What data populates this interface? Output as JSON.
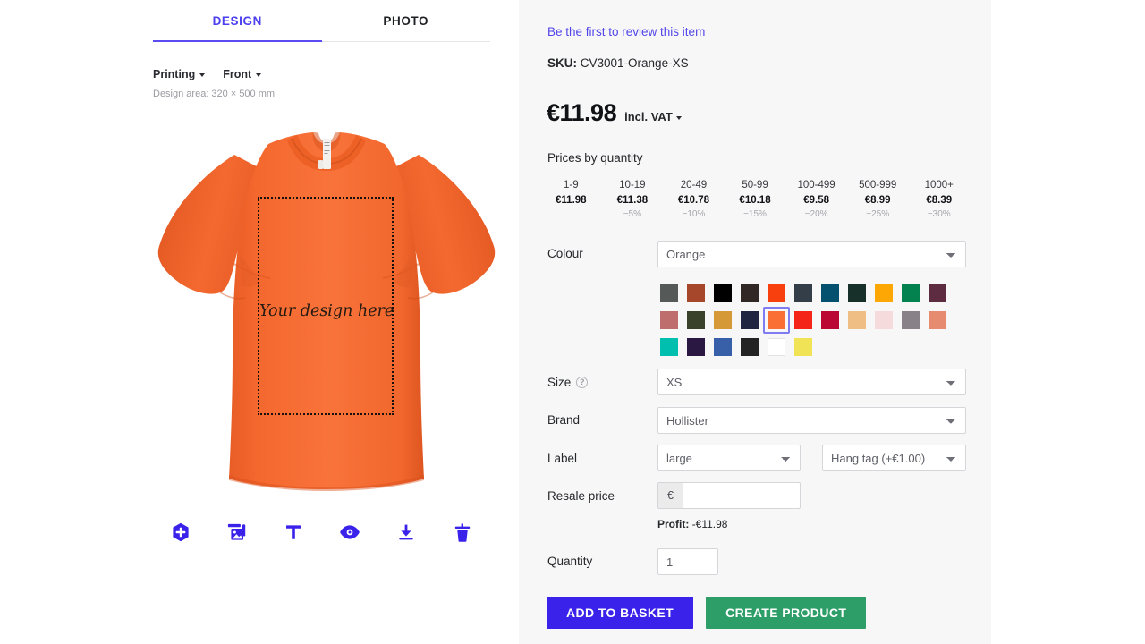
{
  "designer": {
    "tabs": [
      {
        "label": "DESIGN",
        "active": true
      },
      {
        "label": "PHOTO",
        "active": false
      }
    ],
    "controls": {
      "printing_label": "Printing",
      "side_label": "Front",
      "design_area_note": "Design area: 320 × 500 mm"
    },
    "canvas": {
      "design_hint": "Your design here",
      "shirt_colour_name": "Orange",
      "shirt_colour_hex": "#F4682E",
      "shirt_shadow_hex": "#E2551F"
    },
    "toolbar": [
      {
        "icon": "hexagon-plus-icon",
        "name": "add-element-button"
      },
      {
        "icon": "image-icon",
        "name": "add-image-button"
      },
      {
        "icon": "text-icon",
        "name": "add-text-button"
      },
      {
        "icon": "eye-icon",
        "name": "preview-button"
      },
      {
        "icon": "download-icon",
        "name": "download-button"
      },
      {
        "icon": "trash-icon",
        "name": "delete-button"
      }
    ],
    "accent_hex": "#4B3FF0"
  },
  "product": {
    "review_link": "Be the first to review this item",
    "sku_label": "SKU:",
    "sku_value": "CV3001-Orange-XS",
    "price": "€11.98",
    "vat_note": "incl. VAT",
    "qty_prices_title": "Prices by quantity",
    "qty_prices": [
      {
        "range": "1-9",
        "price": "€11.98",
        "discount": ""
      },
      {
        "range": "10-19",
        "price": "€11.38",
        "discount": "−5%"
      },
      {
        "range": "20-49",
        "price": "€10.78",
        "discount": "−10%"
      },
      {
        "range": "50-99",
        "price": "€10.18",
        "discount": "−15%"
      },
      {
        "range": "100-499",
        "price": "€9.58",
        "discount": "−20%"
      },
      {
        "range": "500-999",
        "price": "€8.99",
        "discount": "−25%"
      },
      {
        "range": "1000+",
        "price": "€8.39",
        "discount": "−30%"
      }
    ],
    "fields": {
      "colour_label": "Colour",
      "colour_value": "Orange",
      "size_label": "Size",
      "size_help": "?",
      "size_value": "XS",
      "brand_label": "Brand",
      "brand_value": "Hollister",
      "label_label": "Label",
      "label_size_value": "large",
      "label_type_value": "Hang tag (+€1.00)",
      "resale_label": "Resale price",
      "resale_prefix": "€",
      "resale_value": "",
      "resale_placeholder": "",
      "profit_label": "Profit:",
      "profit_value": "-€11.98",
      "quantity_label": "Quantity",
      "quantity_value": "1"
    },
    "swatches": [
      {
        "hex": "#555A59",
        "name": "asphalt"
      },
      {
        "hex": "#A6462B",
        "name": "rust"
      },
      {
        "hex": "#000000",
        "name": "black"
      },
      {
        "hex": "#312826",
        "name": "dark-chocolate"
      },
      {
        "hex": "#F8400F",
        "name": "bright-orange"
      },
      {
        "hex": "#333E48",
        "name": "slate"
      },
      {
        "hex": "#03506F",
        "name": "petrol-blue"
      },
      {
        "hex": "#17302A",
        "name": "dark-forest"
      },
      {
        "hex": "#FCA703",
        "name": "amber"
      },
      {
        "hex": "#03824F",
        "name": "kelly-green"
      },
      {
        "hex": "#5E2C41",
        "name": "maroon-plum"
      },
      {
        "hex": "#BE6E6C",
        "name": "dusty-rose"
      },
      {
        "hex": "#3B422C",
        "name": "olive"
      },
      {
        "hex": "#D69937",
        "name": "mustard"
      },
      {
        "hex": "#1E2441",
        "name": "navy"
      },
      {
        "hex": "#F96F34",
        "name": "orange",
        "selected": true
      },
      {
        "hex": "#F52419",
        "name": "red"
      },
      {
        "hex": "#BB0734",
        "name": "cardinal"
      },
      {
        "hex": "#EEBE85",
        "name": "peach"
      },
      {
        "hex": "#F5DBDC",
        "name": "blush"
      },
      {
        "hex": "#898188",
        "name": "storm-grey"
      },
      {
        "hex": "#E68B70",
        "name": "coral"
      },
      {
        "hex": "#00BFAE",
        "name": "teal"
      },
      {
        "hex": "#2A1843",
        "name": "deep-purple"
      },
      {
        "hex": "#3860A8",
        "name": "royal-blue"
      },
      {
        "hex": "#232323",
        "name": "charcoal"
      },
      {
        "hex": "#FFFFFF",
        "name": "white",
        "light": true
      },
      {
        "hex": "#F0E456",
        "name": "yellow"
      }
    ],
    "buttons": {
      "add_to_basket": "ADD TO BASKET",
      "create_product": "CREATE PRODUCT"
    },
    "colors": {
      "panel_bg": "#F7F7F7",
      "link": "#5246E8",
      "basket_btn": "#3A22EA",
      "create_btn": "#2E9E68"
    }
  }
}
